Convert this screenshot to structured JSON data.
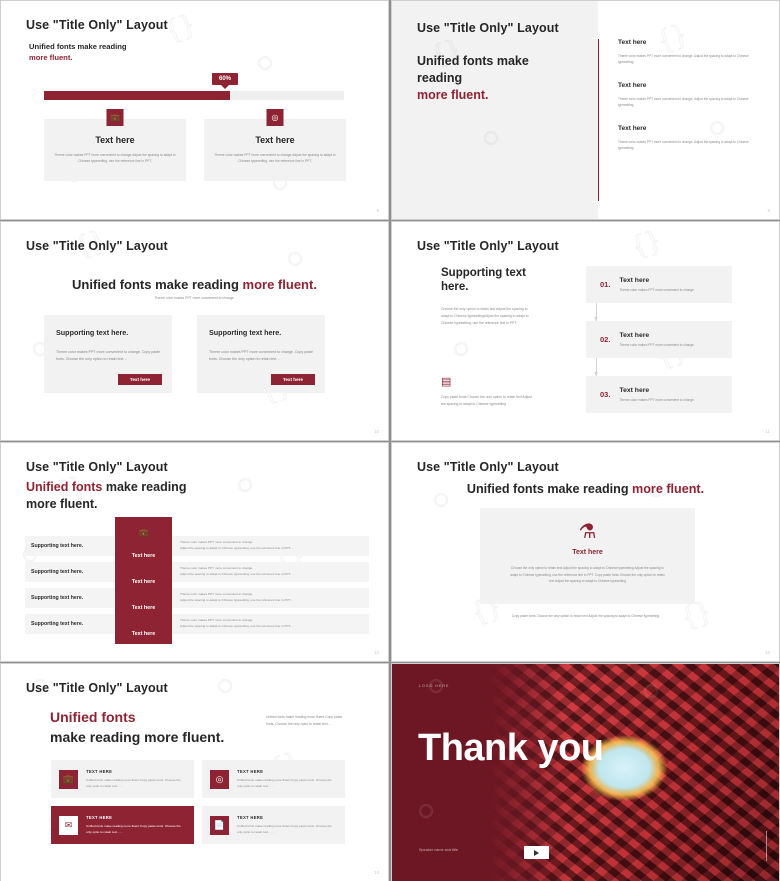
{
  "common": {
    "slide_title": "Use \"Title Only\" Layout",
    "body_theme": "Theme color makes PPT more convenient to change. Adjust the spacing to adapt to Chinese typesetting.",
    "body_theme_short": "Theme  color makes PPT more convenient to change.",
    "accent_color": "#8e2433",
    "panel_color": "#f2f2f2",
    "text_color": "#262626",
    "muted_color": "#8a8a8a"
  },
  "slide1": {
    "title": "Use \"Title Only\" Layout",
    "subtitle_line1": "Unified fonts make reading",
    "subtitle_line2": "more fluent.",
    "progress_label": "60%",
    "progress_value": 60,
    "cards": [
      {
        "icon": "briefcase-icon",
        "heading": "Text here",
        "body": "Theme  color makes PPT more convenient to change.Adjust the spacing to adapt to Chinese typesetting, use the reference line in PPT."
      },
      {
        "icon": "target-icon",
        "heading": "Text here",
        "body": "Theme  color makes PPT more convenient to change.Adjust the spacing to adapt to Chinese typesetting, use the reference line in PPT."
      }
    ],
    "page_number": "9"
  },
  "slide2": {
    "title": "Use \"Title Only\" Layout",
    "big_line1": "Unified fonts make",
    "big_line2": "reading",
    "big_line3": "more fluent.",
    "blocks": [
      {
        "heading": "Text here",
        "body": "Theme color makes PPT more convenient to change. Adjust the spacing to adapt to Chinese typesetting."
      },
      {
        "heading": "Text here",
        "body": "Theme color makes PPT more convenient to change. Adjust the spacing to adapt to Chinese typesetting."
      },
      {
        "heading": "Text here",
        "body": "Theme color makes PPT more convenient to change. Adjust the spacing to adapt to Chinese typesetting."
      }
    ],
    "page_number": "9"
  },
  "slide3": {
    "title": "Use \"Title Only\" Layout",
    "headline_black": "Unified fonts make reading ",
    "headline_accent": "more fluent.",
    "headline_sub": "Theme color makes PPT more convenient to change.",
    "cards": [
      {
        "heading": "Supporting text here.",
        "body": "Theme color makes PPT more convenient to change. Copy paste fonts. Choose the only option to retain text…",
        "button": "Text here"
      },
      {
        "heading": "Supporting text here.",
        "body": "Theme color makes PPT more convenient to change. Copy paste fonts. Choose the only option to retain text…",
        "button": "Text here"
      }
    ],
    "page_number": "10"
  },
  "slide4": {
    "title": "Use \"Title Only\" Layout",
    "lead_line1": "Supporting text",
    "lead_line2": "here.",
    "lead_body": "Choose the only option to retain text Adjust the spacing to adapt to Chinese typesettingAdjust the spacing to adapt to Chinese typesetting, use the reference line in PPT.",
    "footer_icon": "card-icon",
    "footer_body": "Copy paste fonts Choose the only option to retain text Adjust the spacing to adapt to Chinese typesetting",
    "steps": [
      {
        "number": "01.",
        "heading": "Text here",
        "body": "Theme  color makes PPT more convenient to change."
      },
      {
        "number": "02.",
        "heading": "Text here",
        "body": "Theme  color makes PPT more convenient to change."
      },
      {
        "number": "03.",
        "heading": "Text here",
        "body": "Theme  color makes PPT more convenient to change."
      }
    ],
    "page_number": "11"
  },
  "slide5": {
    "title": "Use \"Title Only\" Layout",
    "big_accent": "Unified fonts",
    "big_rest": " make reading",
    "big_line2": "more fluent.",
    "panel_icon": "briefcase-icon",
    "rows": [
      {
        "label": "Supporting text here.",
        "panel": "Text here",
        "body_line1": "Theme color makes PPT more convenient to change.",
        "body_line2": "Adjust the spacing to adapt to Chinese typesetting, use the reference line in PPT.…"
      },
      {
        "label": "Supporting text here.",
        "panel": "Text here",
        "body_line1": "Theme color makes PPT more convenient to change.",
        "body_line2": "Adjust the spacing to adapt to Chinese typesetting, use the reference line in PPT.…"
      },
      {
        "label": "Supporting text here.",
        "panel": "Text here",
        "body_line1": "Theme color makes PPT more convenient to change.",
        "body_line2": "Adjust the spacing to adapt to Chinese typesetting, use the reference line in PPT.…"
      },
      {
        "label": "Supporting text here.",
        "panel": "Text here",
        "body_line1": "Theme color makes PPT more convenient to change.",
        "body_line2": "Adjust the spacing to adapt to Chinese typesetting, use the reference line in PPT.…"
      }
    ],
    "page_number": "12"
  },
  "slide6": {
    "title": "Use \"Title Only\" Layout",
    "headline_black": "Unified fonts make reading ",
    "headline_accent": "more fluent.",
    "panel_icon": "flask-icon",
    "panel_heading": "Text here",
    "panel_body": "Choose the only option to retain text Adjust the spacing to adapt to Chinese typesetting Adjust the spacing to adapt to Chinese typesetting, use the reference line in PPT. Copy paste fonts Choose the only option to retain text Adjust the spacing to adapt to Chinese typesetting",
    "footer_body": "Copy paste fonts Choose the only option to retain text Adjust the spacing to adapt to Chinese typesetting",
    "page_number": "13"
  },
  "slide7": {
    "title": "Use \"Title Only\" Layout",
    "big_accent": "Unified fonts",
    "big_line2": "make reading more fluent.",
    "side_body": "Unified fonts make reading more fluent.Copy paste fonts. Choose the only optio to retain text…",
    "cells": [
      {
        "icon": "briefcase-icon",
        "heading": "TEXT HERE",
        "body": "Unified fonts make reading more fluent.Copy paste fonts. Choose the only optio to retain text……",
        "highlight": false
      },
      {
        "icon": "target-icon",
        "heading": "TEXT HERE",
        "body": "Unified fonts make reading more fluent.Copy paste fonts. Choose the only optio to retain text……",
        "highlight": false
      },
      {
        "icon": "mail-icon",
        "heading": "TEXT HERE",
        "body": "Unified fonts make reading more fluent.Copy paste fonts. Choose the only optio to retain text……",
        "highlight": true
      },
      {
        "icon": "document-icon",
        "heading": "TEXT HERE",
        "body": "Unified fonts make reading more fluent.Copy paste fonts. Choose the only optio to retain text……",
        "highlight": false
      }
    ],
    "page_number": "14"
  },
  "slide8": {
    "logo": "LOGO HERE",
    "thanks": "Thank you",
    "speaker": "Speaker name and title",
    "play_icon": "play-icon"
  }
}
